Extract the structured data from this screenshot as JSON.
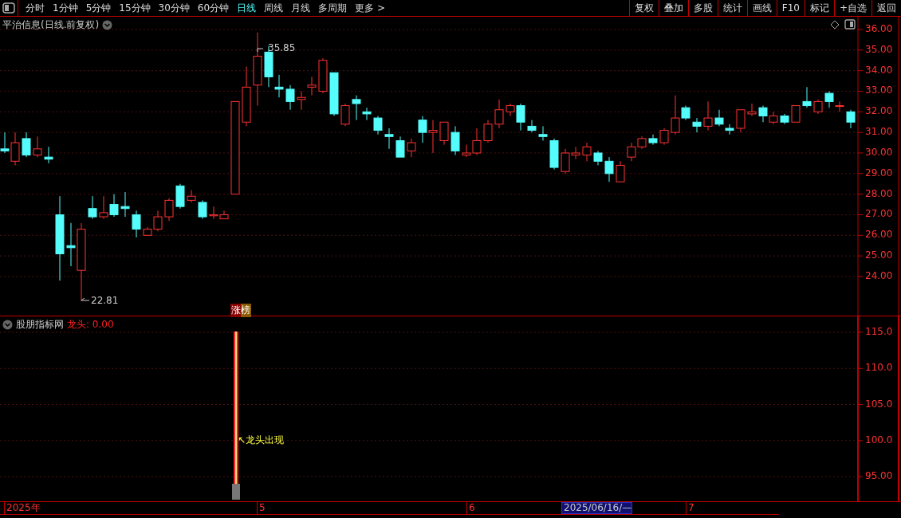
{
  "toolbar": {
    "periods": [
      {
        "label": "分时",
        "selected": false
      },
      {
        "label": "1分钟",
        "selected": false
      },
      {
        "label": "5分钟",
        "selected": false
      },
      {
        "label": "15分钟",
        "selected": false
      },
      {
        "label": "30分钟",
        "selected": false
      },
      {
        "label": "60分钟",
        "selected": false
      },
      {
        "label": "日线",
        "selected": true
      },
      {
        "label": "周线",
        "selected": false
      },
      {
        "label": "月线",
        "selected": false
      },
      {
        "label": "多周期",
        "selected": false
      },
      {
        "label": "更多 >",
        "selected": false
      }
    ],
    "buttons": [
      "复权",
      "叠加",
      "多股",
      "统计",
      "画线",
      "F10",
      "标记",
      "+自选",
      "返回"
    ]
  },
  "price_chart": {
    "title": "平治信息(日线.前复权)",
    "axis_labels": [
      "36.00",
      "35.00",
      "34.00",
      "33.00",
      "32.00",
      "31.00",
      "30.00",
      "29.00",
      "28.00",
      "27.00",
      "26.00",
      "25.00",
      "24.00"
    ],
    "high_label": "35.85",
    "low_label": "22.81",
    "badge": "涨榜"
  },
  "indicator": {
    "title": "股朋指标网",
    "value_label": "龙头: 0.00",
    "axis_labels": [
      "115.0",
      "110.0",
      "105.0",
      "100.0",
      "95.00"
    ],
    "signal_label": "↖龙头出现"
  },
  "date_axis": [
    {
      "label": "2025年",
      "selected": false
    },
    {
      "label": "5",
      "selected": false
    },
    {
      "label": "6",
      "selected": false
    },
    {
      "label": "2025/06/16/—",
      "selected": true
    },
    {
      "label": "7",
      "selected": false
    }
  ]
}
